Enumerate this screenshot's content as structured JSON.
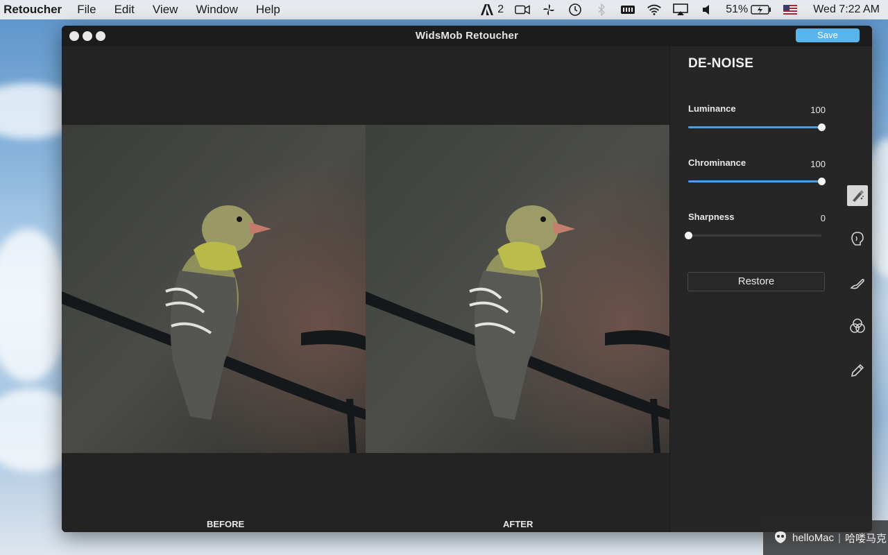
{
  "menubar": {
    "app_name": "o Retoucher",
    "menus": [
      "File",
      "Edit",
      "View",
      "Window",
      "Help"
    ],
    "status_badge_count": "2",
    "battery_percent": "51%",
    "clock": "Wed 7:22 AM",
    "status_icons": [
      "adobe-icon",
      "camera-icon",
      "pinwheel-icon",
      "time-machine-icon",
      "bluetooth-icon",
      "memory-icon",
      "wifi-icon",
      "airplay-icon",
      "volume-icon",
      "battery-icon",
      "flag-icon"
    ]
  },
  "window": {
    "title": "WidsMob Retoucher",
    "save_label": "Save"
  },
  "canvas": {
    "before_label": "BEFORE",
    "after_label": "AFTER"
  },
  "panel": {
    "title": "DE-NOISE",
    "sliders": [
      {
        "label": "Luminance",
        "value": "100",
        "fraction": 1.0
      },
      {
        "label": "Chrominance",
        "value": "100",
        "fraction": 1.0
      },
      {
        "label": "Sharpness",
        "value": "0",
        "fraction": 0.0
      }
    ],
    "restore_label": "Restore"
  },
  "tools": [
    "denoise-brush-icon",
    "face-icon",
    "skin-brush-icon",
    "color-circles-icon",
    "pencil-icon"
  ],
  "watermark": {
    "brand": "helloMac",
    "separator": "|",
    "cn_text": "哈喽马克"
  },
  "colors": {
    "accent": "#4a9fe3",
    "save_button": "#5ab4ec",
    "window_bg": "#232323"
  }
}
